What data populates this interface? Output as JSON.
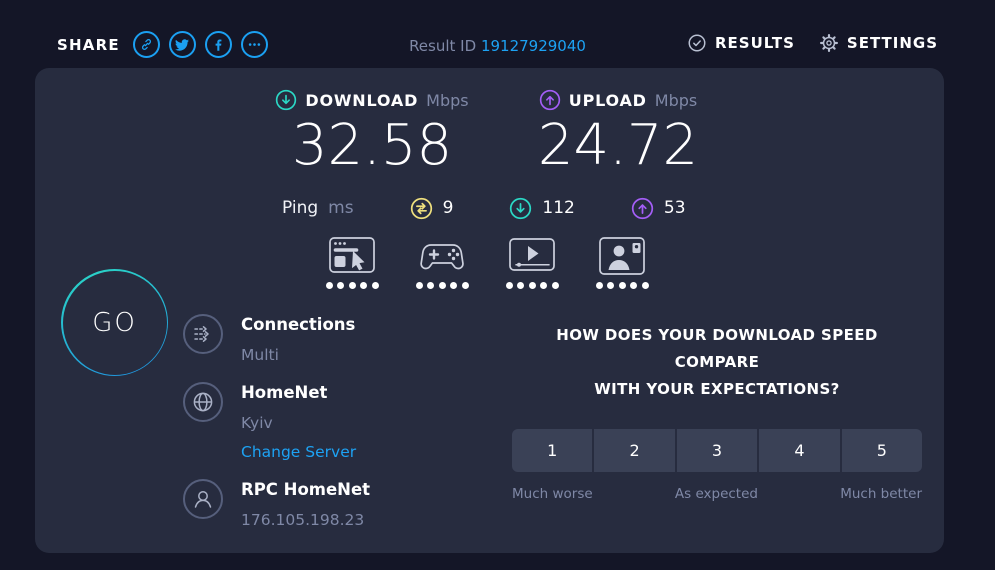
{
  "topbar": {
    "share_label": "SHARE",
    "share_icons": [
      "link-icon",
      "twitter-icon",
      "facebook-icon",
      "more-icon"
    ],
    "result_id_label": "Result ID",
    "result_id_value": "19127929040",
    "results_label": "RESULTS",
    "settings_label": "SETTINGS"
  },
  "speeds": {
    "download": {
      "label": "DOWNLOAD",
      "unit": "Mbps",
      "value": "32.58"
    },
    "upload": {
      "label": "UPLOAD",
      "unit": "Mbps",
      "value": "24.72"
    }
  },
  "ping": {
    "label": "Ping",
    "unit": "ms",
    "idle_value": "9",
    "download_value": "112",
    "upload_value": "53"
  },
  "categories": [
    {
      "icon": "browsing-icon",
      "dots": 5
    },
    {
      "icon": "gaming-icon",
      "dots": 5
    },
    {
      "icon": "streaming-icon",
      "dots": 5
    },
    {
      "icon": "conference-icon",
      "dots": 5
    }
  ],
  "go_button": {
    "label": "GO"
  },
  "connection_info": {
    "connections": {
      "title": "Connections",
      "value": "Multi"
    },
    "server": {
      "title": "HomeNet",
      "location": "Kyiv",
      "change_link": "Change Server"
    },
    "isp": {
      "title": "RPC HomeNet",
      "ip": "176.105.198.23"
    }
  },
  "survey": {
    "question_line1": "HOW DOES YOUR DOWNLOAD SPEED COMPARE",
    "question_line2": "WITH YOUR EXPECTATIONS?",
    "ratings": [
      "1",
      "2",
      "3",
      "4",
      "5"
    ],
    "scale_low": "Much worse",
    "scale_mid": "As expected",
    "scale_high": "Much better"
  },
  "colors": {
    "background": "#141627",
    "panel": "#272c3f",
    "accent_blue": "#1da2f3",
    "accent_teal": "#2bd8c5",
    "accent_purple": "#a45ef7",
    "accent_yellow": "#efe07e",
    "muted_text": "#7f88a6",
    "button_bg": "#3a4156"
  }
}
